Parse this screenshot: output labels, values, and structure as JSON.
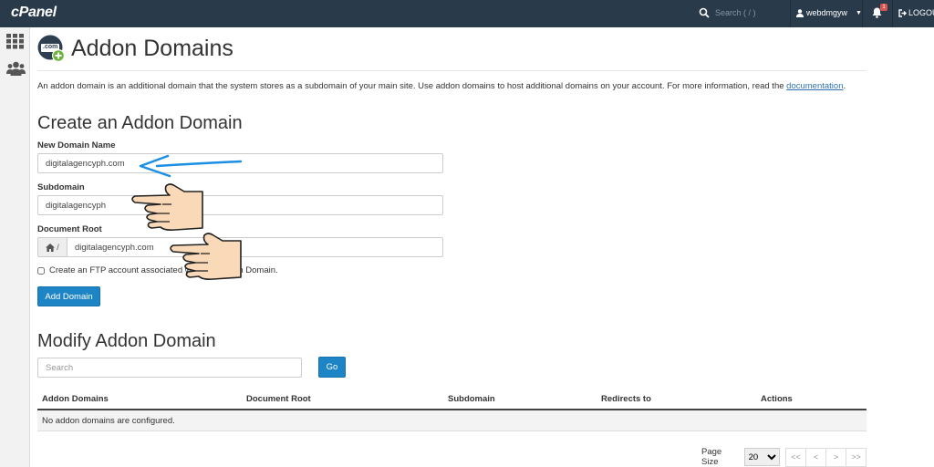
{
  "topbar": {
    "logo": "cPanel",
    "search_placeholder": "Search ( / )",
    "username": "webdmgyw",
    "notification_count": "1",
    "logout": "LOGOUT"
  },
  "page": {
    "title": "Addon Domains",
    "icon_text": ".com",
    "description_text": "An addon domain is an additional domain that the system stores as a subdomain of your main site. Use addon domains to host additional domains on your account. For more information, read the ",
    "description_link": "documentation",
    "description_end": "."
  },
  "create": {
    "heading": "Create an Addon Domain",
    "new_domain_label": "New Domain Name",
    "new_domain_value": "digitalagencyph.com",
    "subdomain_label": "Subdomain",
    "subdomain_value": "digitalagencyph",
    "docroot_label": "Document Root",
    "docroot_prefix": "/",
    "docroot_value": "digitalagencyph.com",
    "ftp_label": "Create an FTP account associated with this Addon Domain.",
    "add_button": "Add Domain"
  },
  "modify": {
    "heading": "Modify Addon Domain",
    "search_placeholder": "Search",
    "go_button": "Go",
    "columns": [
      "Addon Domains",
      "Document Root",
      "Subdomain",
      "Redirects to",
      "Actions"
    ],
    "empty_message": "No addon domains are configured.",
    "page_size_label": "Page Size",
    "page_size_value": "20",
    "pager": [
      "<<",
      "<",
      ">",
      ">>"
    ]
  },
  "colors": {
    "topbar": "#293a4a",
    "primary_button": "#1d85c6",
    "link": "#3072b3",
    "arrow": "#1a8fe3"
  }
}
